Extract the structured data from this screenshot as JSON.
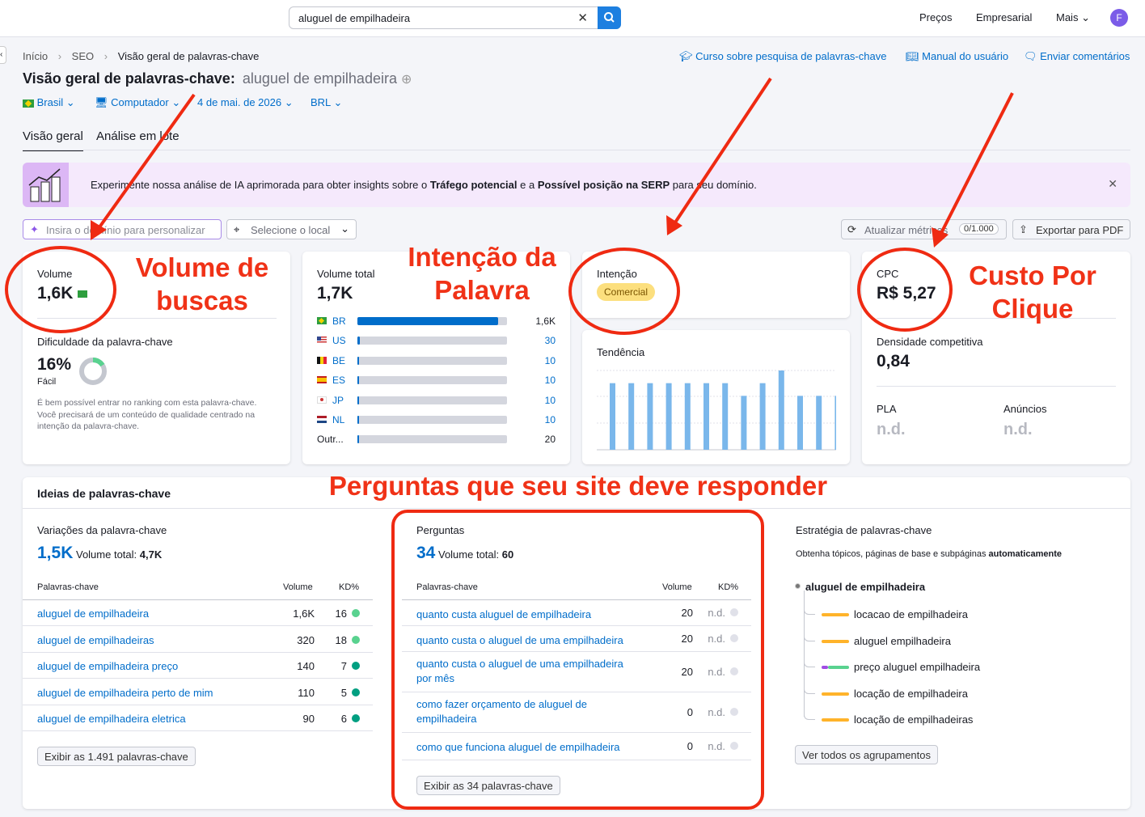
{
  "search": {
    "query": "aluguel de empilhadeira"
  },
  "topnav": {
    "precos": "Preços",
    "empresarial": "Empresarial",
    "mais": "Mais",
    "avatar": "F"
  },
  "breadcrumb": [
    "Início",
    "SEO",
    "Visão geral de palavras-chave"
  ],
  "helplinks": {
    "curso": "Curso sobre pesquisa de palavras-chave",
    "manual": "Manual do usuário",
    "feedback": "Enviar comentários"
  },
  "page": {
    "title": "Visão geral de palavras-chave:",
    "keyword": "aluguel de empilhadeira"
  },
  "filters": {
    "country": "Brasil",
    "device": "Computador",
    "date": "4 de mai. de 2026",
    "currency": "BRL"
  },
  "tabs": [
    "Visão geral",
    "Análise em lote"
  ],
  "banner": {
    "text1": "Experimente nossa análise de IA aprimorada para obter insights sobre o",
    "bold1": "Tráfego potencial",
    "text2": "e a",
    "bold2": "Possível posição na SERP",
    "text3": "para seu domínio."
  },
  "toolbar": {
    "domain_placeholder": "Insira o domínio para personalizar",
    "location": "Selecione o local",
    "update": "Atualizar métricas",
    "update_count": "0/1.000",
    "export": "Exportar para PDF"
  },
  "volume": {
    "label": "Volume",
    "value": "1,6K",
    "kd_label": "Dificuldade da palavra-chave",
    "kd_value": "16%",
    "kd_level": "Fácil",
    "kd_fraction": 0.16,
    "kd_desc": "É bem possível entrar no ranking com esta palavra-chave. Você precisará de um conteúdo de qualidade centrado na intenção da palavra-chave."
  },
  "global": {
    "label": "Volume total",
    "value": "1,7K",
    "rows": [
      {
        "code": "BR",
        "value": "1,6K",
        "fraction": 0.94
      },
      {
        "code": "US",
        "value": "30",
        "fraction": 0.018
      },
      {
        "code": "BE",
        "value": "10",
        "fraction": 0.006
      },
      {
        "code": "ES",
        "value": "10",
        "fraction": 0.006
      },
      {
        "code": "JP",
        "value": "10",
        "fraction": 0.006
      },
      {
        "code": "NL",
        "value": "10",
        "fraction": 0.006
      },
      {
        "code": "Outr...",
        "value": "20",
        "fraction": 0.012
      }
    ]
  },
  "intent": {
    "label": "Intenção",
    "badge": "Comercial"
  },
  "trend": {
    "label": "Tendência",
    "values": [
      0.84,
      0.84,
      0.84,
      0.84,
      0.84,
      0.84,
      0.84,
      0.68,
      0.84,
      1.0,
      0.68,
      0.68,
      0.68
    ]
  },
  "cpc": {
    "label": "CPC",
    "value": "R$ 5,27",
    "density_label": "Densidade competitiva",
    "density_value": "0,84",
    "pla_label": "PLA",
    "pla_value": "n.d.",
    "ads_label": "Anúncios",
    "ads_value": "n.d."
  },
  "ideas": {
    "title": "Ideias de palavras-chave",
    "variations": {
      "title": "Variações da palavra-chave",
      "count": "1,5K",
      "total_label": "Volume total:",
      "total": "4,7K",
      "col_kw": "Palavras-chave",
      "col_vol": "Volume",
      "col_kd": "KD%",
      "rows": [
        {
          "kw": "aluguel de empilhadeira",
          "vol": "1,6K",
          "kd": "16",
          "color": "#59d28f"
        },
        {
          "kw": "aluguel de empilhadeiras",
          "vol": "320",
          "kd": "18",
          "color": "#59d28f"
        },
        {
          "kw": "aluguel de empilhadeira preço",
          "vol": "140",
          "kd": "7",
          "color": "#009f81"
        },
        {
          "kw": "aluguel de empilhadeira perto de mim",
          "vol": "110",
          "kd": "5",
          "color": "#009f81"
        },
        {
          "kw": "aluguel de empilhadeira eletrica",
          "vol": "90",
          "kd": "6",
          "color": "#009f81"
        }
      ],
      "button": "Exibir as 1.491 palavras-chave"
    },
    "questions": {
      "title": "Perguntas",
      "count": "34",
      "total_label": "Volume total:",
      "total": "60",
      "col_kw": "Palavras-chave",
      "col_vol": "Volume",
      "col_kd": "KD%",
      "rows": [
        {
          "kw": "quanto custa aluguel de empilhadeira",
          "vol": "20",
          "kd": "n.d."
        },
        {
          "kw": "quanto custa o aluguel de uma empilhadeira",
          "vol": "20",
          "kd": "n.d."
        },
        {
          "kw": "quanto custa o aluguel de uma empilhadeira por mês",
          "vol": "20",
          "kd": "n.d."
        },
        {
          "kw": "como fazer orçamento de aluguel de empilhadeira",
          "vol": "0",
          "kd": "n.d."
        },
        {
          "kw": "como que funciona aluguel de empilhadeira",
          "vol": "0",
          "kd": "n.d."
        }
      ],
      "button": "Exibir as 34 palavras-chave"
    },
    "strategy": {
      "title": "Estratégia de palavras-chave",
      "subtitle": "Obtenha tópicos, páginas de base e subpáginas",
      "subtitle_bold": "automaticamente",
      "root": "aluguel de empilhadeira",
      "items": [
        "locacao de empilhadeira",
        "aluguel empilhadeira",
        "preço aluguel empilhadeira",
        "locação de empilhadeira",
        "locação de empilhadeiras"
      ],
      "button": "Ver todos os agrupamentos"
    }
  },
  "annotations": {
    "volume": [
      "Volume de",
      "buscas"
    ],
    "intent": [
      "Intenção da",
      "Palavra"
    ],
    "cpc": [
      "Custo Por",
      "Clique"
    ],
    "questions": "Perguntas que seu site deve responder"
  }
}
